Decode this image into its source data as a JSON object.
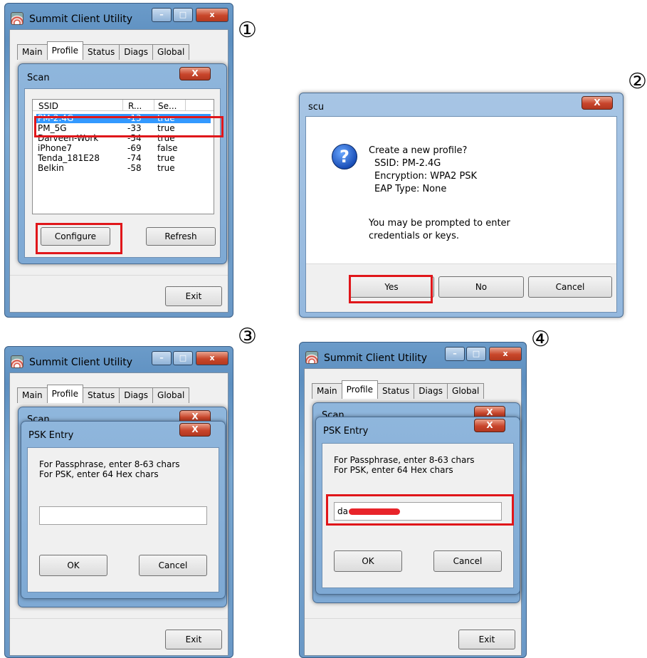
{
  "steps": [
    "①",
    "②",
    "③",
    "④"
  ],
  "app": {
    "title": "Summit Client Utility",
    "tabs": [
      "Main",
      "Profile",
      "Status",
      "Diags",
      "Global"
    ],
    "exit_label": "Exit",
    "min_glyph": "–",
    "max_glyph": "□",
    "close_glyph": "x"
  },
  "scan": {
    "title": "Scan",
    "columns": [
      "SSID",
      "R...",
      "Se..."
    ],
    "rows": [
      {
        "ssid": "PM-2.4G",
        "rssi": "-13",
        "sec": "true",
        "selected": true
      },
      {
        "ssid": "PM_5G",
        "rssi": "-33",
        "sec": "true",
        "selected": false
      },
      {
        "ssid": "Darveen-Work",
        "rssi": "-54",
        "sec": "true",
        "selected": false
      },
      {
        "ssid": "iPhone7",
        "rssi": "-69",
        "sec": "false",
        "selected": false
      },
      {
        "ssid": "Tenda_181E28",
        "rssi": "-74",
        "sec": "true",
        "selected": false
      },
      {
        "ssid": "Belkin",
        "rssi": "-58",
        "sec": "true",
        "selected": false
      }
    ],
    "configure_label": "Configure",
    "refresh_label": "Refresh",
    "close_glyph": "X"
  },
  "scu": {
    "title": "scu",
    "line1": "Create a new profile?",
    "line2": "SSID: PM-2.4G",
    "line3": "Encryption: WPA2 PSK",
    "line4": "EAP Type: None",
    "line5": "You may be prompted to enter",
    "line6": "credentials or keys.",
    "yes_label": "Yes",
    "no_label": "No",
    "cancel_label": "Cancel",
    "close_glyph": "X",
    "question_glyph": "?"
  },
  "psk": {
    "title": "PSK Entry",
    "behind_title": "Scan",
    "hint1": "For Passphrase, enter 8-63 chars",
    "hint2": "For PSK, enter 64 Hex chars",
    "empty_value": "",
    "typed_value": "da",
    "ok_label": "OK",
    "cancel_label": "Cancel",
    "close_glyph": "X"
  },
  "colors": {
    "highlight": "#e0161a",
    "selection": "#3399ff",
    "redact": "#e8242a"
  }
}
